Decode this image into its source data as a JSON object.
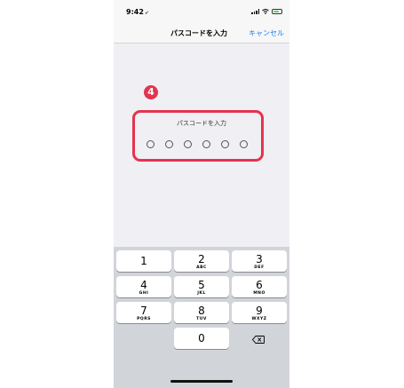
{
  "status_bar": {
    "time": "9:42",
    "location_glyph": "➶"
  },
  "nav": {
    "title": "パスコードを入力",
    "cancel_label": "キャンセル"
  },
  "step_badge": "4",
  "passcode": {
    "prompt": "パスコードを入力",
    "dot_count": 6
  },
  "keypad": {
    "keys": [
      {
        "num": "1",
        "letters": ""
      },
      {
        "num": "2",
        "letters": "ABC"
      },
      {
        "num": "3",
        "letters": "DEF"
      },
      {
        "num": "4",
        "letters": "GHI"
      },
      {
        "num": "5",
        "letters": "JKL"
      },
      {
        "num": "6",
        "letters": "MNO"
      },
      {
        "num": "7",
        "letters": "PQRS"
      },
      {
        "num": "8",
        "letters": "TUV"
      },
      {
        "num": "9",
        "letters": "WXYZ"
      },
      {
        "num": "0",
        "letters": ""
      }
    ]
  },
  "colors": {
    "accent": "#1a7df2",
    "highlight": "#e5334e",
    "battery": "#4cd964"
  }
}
